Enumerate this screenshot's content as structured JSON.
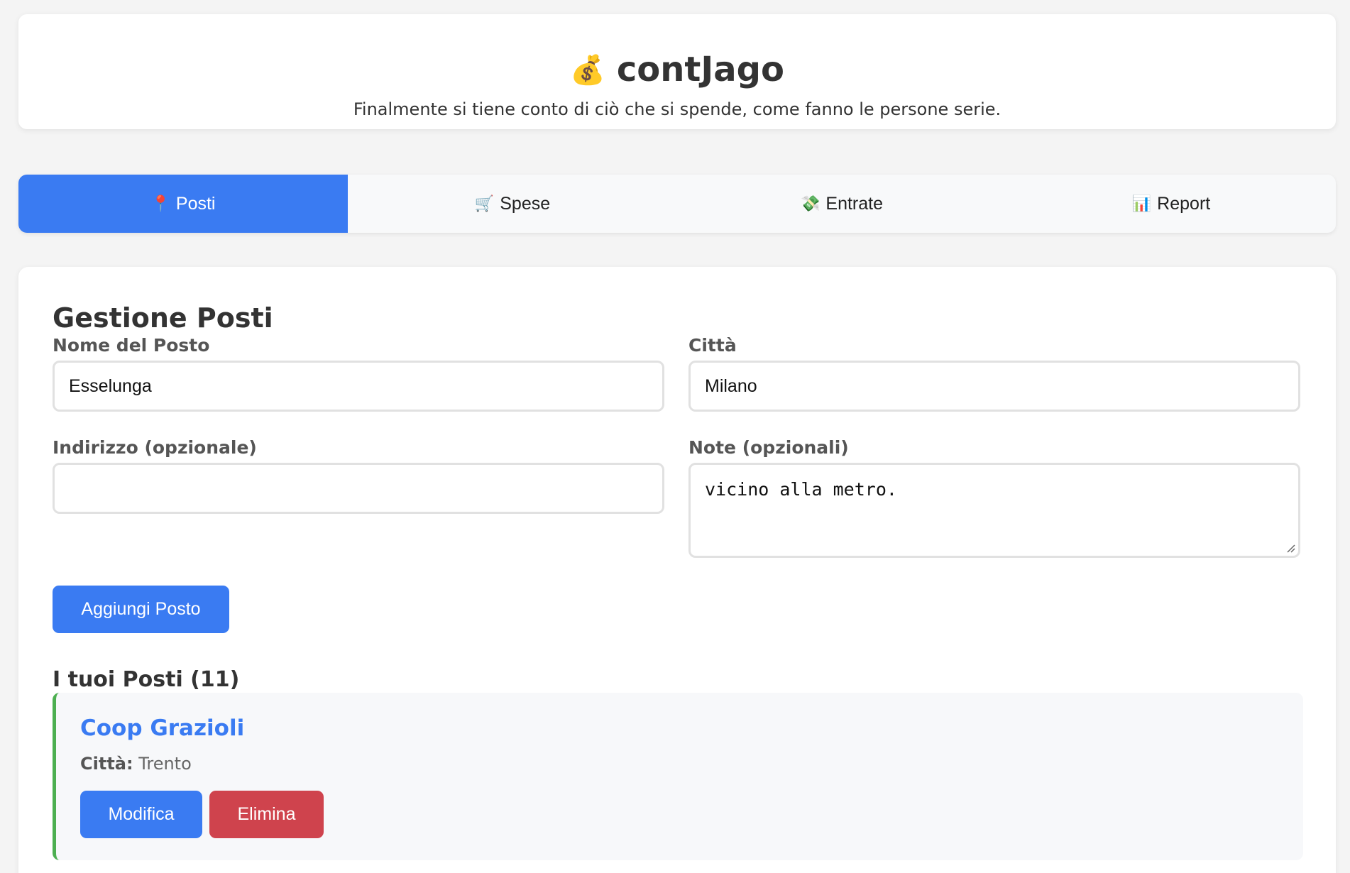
{
  "header": {
    "icon": "money-bag-icon",
    "icon_glyph": "💰",
    "title": "contJago",
    "subtitle": "Finalmente si tiene conto di ciò che si spende, come fanno le persone serie."
  },
  "tabs": [
    {
      "label": "Posti",
      "icon": "pushpin-icon",
      "glyph": "📍",
      "active": true
    },
    {
      "label": "Spese",
      "icon": "shopping-cart-icon",
      "glyph": "🛒",
      "active": false
    },
    {
      "label": "Entrate",
      "icon": "money-wings-icon",
      "glyph": "💸",
      "active": false
    },
    {
      "label": "Report",
      "icon": "bar-chart-icon",
      "glyph": "📊",
      "active": false
    }
  ],
  "form": {
    "title": "Gestione Posti",
    "name_label": "Nome del Posto",
    "name_value": "Esselunga",
    "city_label": "Città",
    "city_value": "Milano",
    "address_label": "Indirizzo (opzionale)",
    "address_value": "",
    "notes_label": "Note (opzionali)",
    "notes_value": "vicino alla metro.",
    "submit_label": "Aggiungi Posto"
  },
  "list": {
    "title": "I tuoi Posti (11)",
    "items": [
      {
        "name": "Coop Grazioli",
        "city_label": "Città:",
        "city": "Trento",
        "edit_label": "Modifica",
        "delete_label": "Elimina"
      }
    ]
  },
  "colors": {
    "accent": "#3a7bf2",
    "danger": "#cf434d",
    "card_border": "#4caf50"
  }
}
